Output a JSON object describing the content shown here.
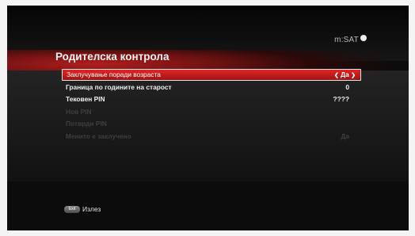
{
  "header": {
    "brand": "m:SAT",
    "title": "Родителска контрола"
  },
  "menu": {
    "rows": [
      {
        "label": "Заклучување поради возраста",
        "value": "Да",
        "state": "selected"
      },
      {
        "label": "Граница по годините на старост",
        "value": "0",
        "state": "enabled"
      },
      {
        "label": "Тековен PIN",
        "value": "????",
        "state": "enabled"
      },
      {
        "label": "Нов PIN",
        "value": "",
        "state": "disabled"
      },
      {
        "label": "Потврди PIN",
        "value": "",
        "state": "disabled"
      },
      {
        "label": "Менито е заклучено",
        "value": "Да",
        "state": "disabled"
      }
    ],
    "arrow_left": "❮",
    "arrow_right": "❯"
  },
  "footer": {
    "key_label": "Exit",
    "action_label": "Излез"
  },
  "colors": {
    "highlight": "#d11f1f",
    "background": "#0c0c0c",
    "disabled_text": "#3f3f3f"
  }
}
